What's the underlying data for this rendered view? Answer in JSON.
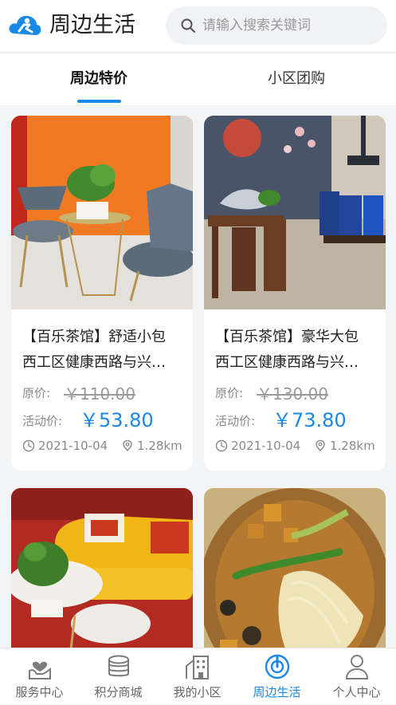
{
  "header": {
    "logo_icon": "people-logo-icon",
    "title": "周边生活",
    "search_placeholder": "请输入搜索关键词"
  },
  "tabs": [
    {
      "label": "周边特价",
      "active": true
    },
    {
      "label": "小区团购",
      "active": false
    }
  ],
  "products": [
    {
      "title": "【百乐茶馆】舒适小包",
      "address": "西工区健康西路与兴…",
      "original_label": "原价:",
      "original_price": "￥110.00",
      "activity_label": "活动价:",
      "activity_price": "￥53.80",
      "date": "2021-10-04",
      "distance": "1.28km"
    },
    {
      "title": "【百乐茶馆】豪华大包",
      "address": "西工区健康西路与兴…",
      "original_label": "原价:",
      "original_price": "￥130.00",
      "activity_label": "活动价:",
      "activity_price": "￥73.80",
      "date": "2021-10-04",
      "distance": "1.28km"
    },
    {
      "title": "",
      "address": ""
    },
    {
      "title": "",
      "address": ""
    }
  ],
  "bottom_nav": [
    {
      "label": "服务中心",
      "icon": "heart-hand-icon",
      "active": false
    },
    {
      "label": "积分商城",
      "icon": "coin-stack-icon",
      "active": false
    },
    {
      "label": "我的小区",
      "icon": "building-icon",
      "active": false
    },
    {
      "label": "周边生活",
      "icon": "location-target-icon",
      "active": true
    },
    {
      "label": "个人中心",
      "icon": "person-icon",
      "active": false
    }
  ],
  "colors": {
    "accent": "#1a88e6",
    "background": "#f3f4f6",
    "muted_text": "#8a8a8a"
  }
}
